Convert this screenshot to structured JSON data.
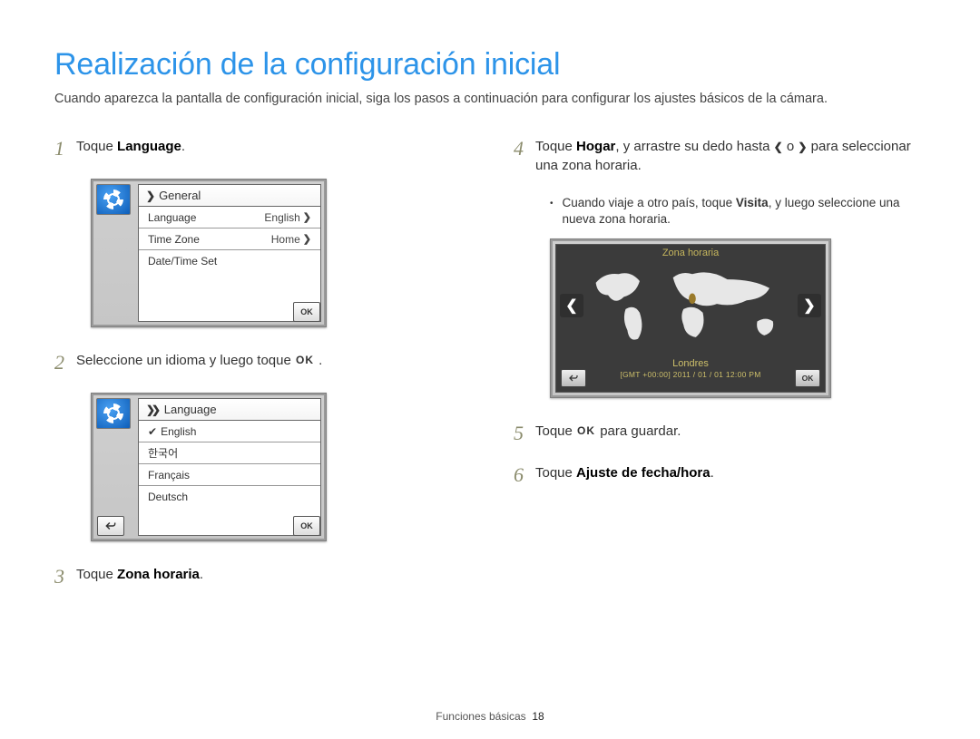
{
  "title": "Realización de la configuración inicial",
  "intro": "Cuando aparezca la pantalla de configuración inicial, siga los pasos a continuación para configurar los ajustes básicos de la cámara.",
  "steps": {
    "s1": {
      "num": "1",
      "pre": "Toque ",
      "bold": "Language",
      "post": "."
    },
    "s2": {
      "num": "2",
      "pre": "Seleccione un idioma y luego toque ",
      "ok_symbol": "OK",
      "post": " ."
    },
    "s3": {
      "num": "3",
      "pre": "Toque ",
      "bold": "Zona horaria",
      "post": "."
    },
    "s4": {
      "num": "4",
      "pre": "Toque ",
      "bold": "Hogar",
      "post1": ", y arrastre su dedo hasta ",
      "chev_l": "❮",
      "mid": " o ",
      "chev_r": "❯",
      "post2": " para seleccionar una zona horaria."
    },
    "s4_sub": {
      "pre": "Cuando viaje a otro país, toque ",
      "bold": "Visita",
      "post": ", y luego seleccione una nueva zona horaria."
    },
    "s5": {
      "num": "5",
      "pre": "Toque ",
      "ok_symbol": "OK",
      "post": " para guardar."
    },
    "s6": {
      "num": "6",
      "pre": "Toque ",
      "bold": "Ajuste de fecha/hora",
      "post": "."
    }
  },
  "screenshot1": {
    "header": "General",
    "rows": [
      {
        "label": "Language",
        "value": "English"
      },
      {
        "label": "Time Zone",
        "value": "Home"
      },
      {
        "label": "Date/Time Set",
        "value": ""
      }
    ],
    "ok": "OK"
  },
  "screenshot2": {
    "header": "Language",
    "rows": [
      "English",
      "한국어",
      "Français",
      "Deutsch"
    ],
    "ok": "OK"
  },
  "screenshot3": {
    "title": "Zona horaria",
    "city": "Londres",
    "gmt": "[GMT +00:00]   2011 / 01 / 01  12:00 PM",
    "ok": "OK"
  },
  "footer": {
    "section": "Funciones básicas",
    "page": "18"
  }
}
